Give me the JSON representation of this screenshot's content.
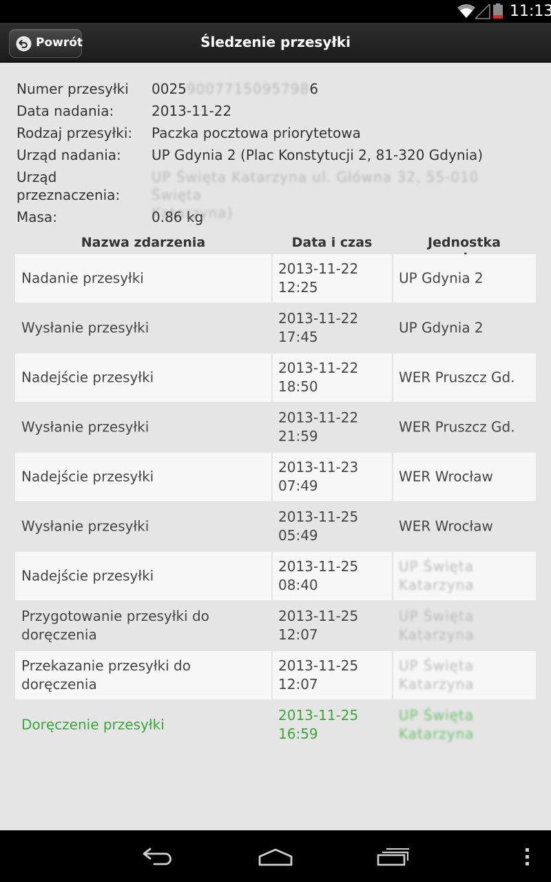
{
  "status_bar": {
    "time": "11:13",
    "icons": [
      "wifi-icon",
      "signal-icon",
      "battery-low-icon"
    ],
    "battery_color": "#d32f2f"
  },
  "header": {
    "back_label": "Powrót",
    "title": "Śledzenie przesyłki"
  },
  "shipment": {
    "number_label": "Numer przesyłki",
    "number_prefix": "0025",
    "number_hidden": "9007715095798",
    "number_suffix": "6",
    "sent_date_label": "Data nadania:",
    "sent_date": "2013-11-22",
    "type_label": "Rodzaj przesyłki:",
    "type": "Paczka pocztowa priorytetowa",
    "origin_label": "Urząd nadania:",
    "origin": "UP Gdynia 2 (Plac Konstytucji 2, 81-320 Gdynia)",
    "destination_label_1": "Urząd",
    "destination_label_2": "przeznaczenia:",
    "destination_line_1": "UP Święta Katarzyna ul. Główna 32, 55-010 Święta",
    "destination_line_2": "Katarzyna)",
    "weight_label": "Masa:",
    "weight": "0.86 kg"
  },
  "table": {
    "headers": {
      "event": "Nazwa zdarzenia",
      "datetime": "Data i czas",
      "unit": "Jednostka pocztowa"
    },
    "rows": [
      {
        "event": "Nadanie przesyłki",
        "date": "2013-11-22",
        "time": "12:25",
        "unit": "UP Gdynia 2",
        "unit_line_2": ""
      },
      {
        "event": "Wysłanie przesyłki",
        "date": "2013-11-22",
        "time": "17:45",
        "unit": "UP Gdynia 2",
        "unit_line_2": ""
      },
      {
        "event": "Nadejście przesyłki",
        "date": "2013-11-22",
        "time": "18:50",
        "unit": "WER Pruszcz Gd.",
        "unit_line_2": ""
      },
      {
        "event": "Wysłanie przesyłki",
        "date": "2013-11-22",
        "time": "21:59",
        "unit": "WER Pruszcz Gd.",
        "unit_line_2": ""
      },
      {
        "event": "Nadejście przesyłki",
        "date": "2013-11-23",
        "time": "07:49",
        "unit": "WER Wrocław",
        "unit_line_2": ""
      },
      {
        "event": "Wysłanie przesyłki",
        "date": "2013-11-25",
        "time": "05:49",
        "unit": "WER Wrocław",
        "unit_line_2": ""
      },
      {
        "event": "Nadejście przesyłki",
        "date": "2013-11-25",
        "time": "08:40",
        "unit": "UP Święta",
        "unit_line_2": "Katarzyna"
      },
      {
        "event": "Przygotowanie przesyłki do doręczenia",
        "date": "2013-11-25",
        "time": "12:07",
        "unit": "UP Święta",
        "unit_line_2": "Katarzyna"
      },
      {
        "event": "Przekazanie przesyłki do doręczenia",
        "date": "2013-11-25",
        "time": "12:07",
        "unit": "UP Święta",
        "unit_line_2": "Katarzyna"
      },
      {
        "event": "Doręczenie przesyłki",
        "date": "2013-11-25",
        "time": "16:59",
        "unit": "UP Święta",
        "unit_line_2": "Katarzyna"
      }
    ],
    "delivered_color": "#3aa63a"
  },
  "nav_bar": {
    "icons": [
      "back-icon",
      "home-icon",
      "recent-apps-icon",
      "overflow-menu-icon"
    ]
  }
}
